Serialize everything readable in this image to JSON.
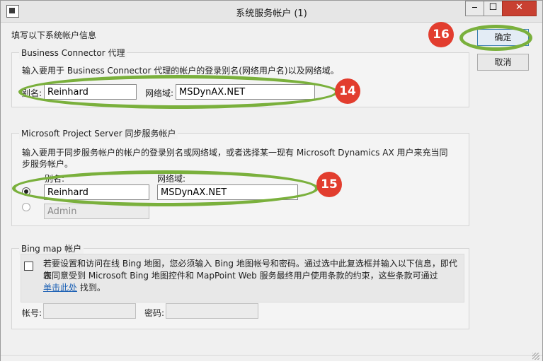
{
  "window": {
    "title": "系统服务帐户 (1)",
    "controls": {
      "minimize": "‒",
      "maximize": "☐",
      "close": "✕"
    }
  },
  "intro_label": "填写以下系统帐户信息",
  "business_connector": {
    "title": "Business Connector 代理",
    "description": "输入要用于 Business Connector 代理的帐户的登录别名(网络用户名)以及网络域。",
    "alias_label": "别名:",
    "alias_value": "Reinhard",
    "domain_label": "网络域:",
    "domain_value": "MSDynAX.NET"
  },
  "project_server": {
    "title": "Microsoft Project Server 同步服务帐户",
    "description_line1": "输入要用于同步服务帐户的帐户的登录别名或网络域，或者选择某一现有 Microsoft Dynamics AX 用户来充当同",
    "description_line2": "步服务帐户。",
    "alias_label": "别名:",
    "domain_label": "网络域:",
    "alias_value": "Reinhard",
    "domain_value": "MSDynAX.NET",
    "existing_user_value": "Admin"
  },
  "bing": {
    "title": "Bing map 帐户",
    "notice_line1": "若要设置和访问在线 Bing 地图，您必须输入 Bing 地图帐号和密码。通过选中此复选框并输入以下信息，即代表",
    "notice_line2": "您同意受到 Microsoft Bing 地图控件和 MapPoint Web 服务最终用户使用条款的约束，这些条款可通过",
    "link_text": "单击此处",
    "notice_tail": " 找到。",
    "account_label": "帐号:",
    "password_label": "密码:"
  },
  "buttons": {
    "ok": "确定",
    "cancel": "取消"
  },
  "callouts": {
    "a": "14",
    "b": "15",
    "c": "16"
  },
  "colors": {
    "highlight_oval": "#7ab03c",
    "badge": "#e23d2e"
  }
}
